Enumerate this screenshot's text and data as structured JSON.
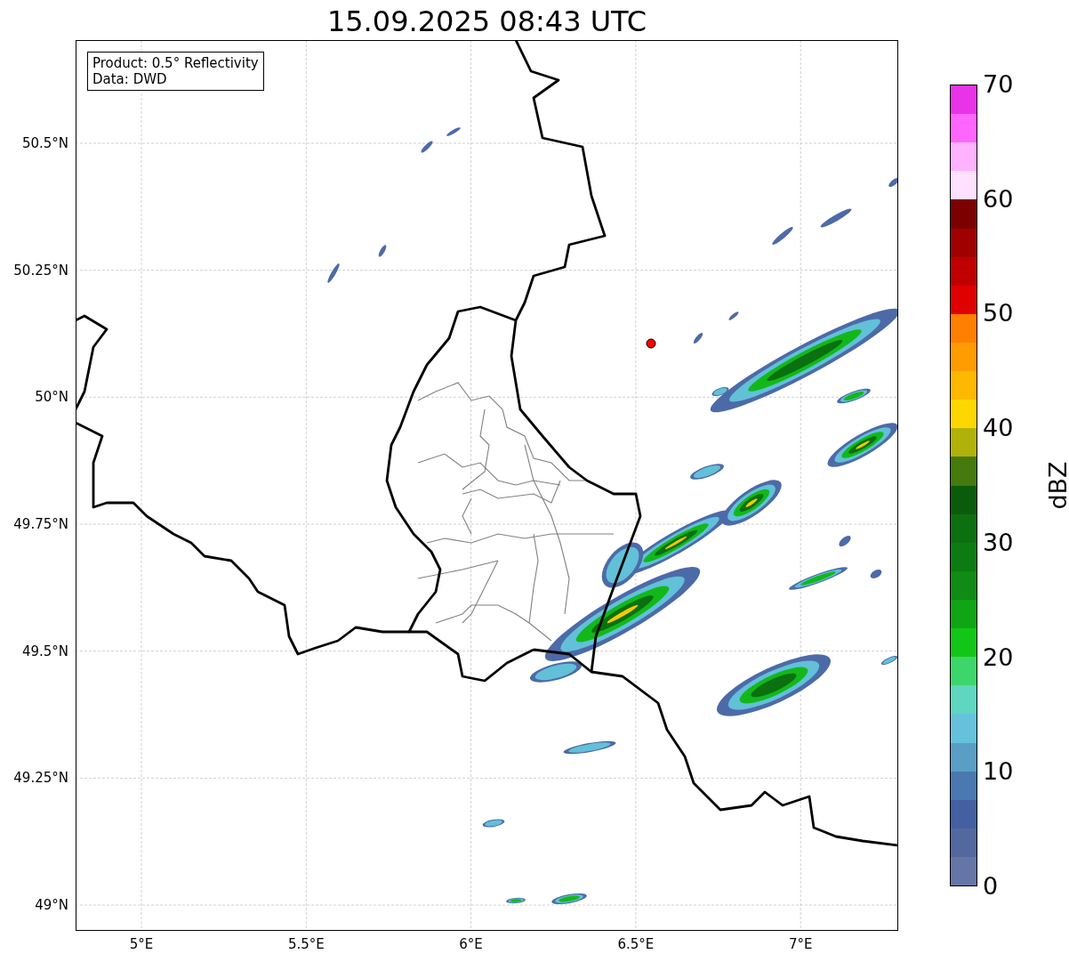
{
  "title": "15.09.2025 08:43 UTC",
  "legend": {
    "lines": [
      "Product: 0.5° Reflectivity",
      "Data: DWD"
    ]
  },
  "y_ticks": [
    "50.5°N",
    "50.25°N",
    "50°N",
    "49.75°N",
    "49.5°N",
    "49.25°N",
    "49°N"
  ],
  "x_ticks": [
    "5°E",
    "5.5°E",
    "6°E",
    "6.5°E",
    "7°E"
  ],
  "colorbar": {
    "label": "dBZ",
    "ticks": [
      "70",
      "60",
      "50",
      "40",
      "30",
      "20",
      "10",
      "0"
    ],
    "segments": [
      {
        "color": "#e833e8"
      },
      {
        "color": "#ff66ff"
      },
      {
        "color": "#ffb3ff"
      },
      {
        "color": "#ffe0ff"
      },
      {
        "color": "#7c0000"
      },
      {
        "color": "#a00000"
      },
      {
        "color": "#c00000"
      },
      {
        "color": "#e00000"
      },
      {
        "color": "#ff8000"
      },
      {
        "color": "#ff9c00"
      },
      {
        "color": "#ffb800"
      },
      {
        "color": "#ffd700"
      },
      {
        "color": "#b0b20a"
      },
      {
        "color": "#457a0c"
      },
      {
        "color": "#0a5c0c"
      },
      {
        "color": "#0c6f10"
      },
      {
        "color": "#0c7c12"
      },
      {
        "color": "#0e8c14"
      },
      {
        "color": "#10a515"
      },
      {
        "color": "#12c618"
      },
      {
        "color": "#3dd66b"
      },
      {
        "color": "#5fd6c0"
      },
      {
        "color": "#66c2dc"
      },
      {
        "color": "#5a9ec5"
      },
      {
        "color": "#4a78b0"
      },
      {
        "color": "#4460a3"
      },
      {
        "color": "#5468a0"
      },
      {
        "color": "#6675a8"
      }
    ]
  }
}
